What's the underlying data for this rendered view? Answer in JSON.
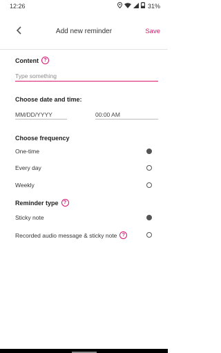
{
  "status_bar": {
    "time": "12:26",
    "battery": "31%",
    "icons": [
      "location-icon",
      "wifi-icon",
      "signal-icon",
      "battery-icon"
    ]
  },
  "app_bar": {
    "back_icon": "back-chevron-icon",
    "title": "Add new reminder",
    "save_label": "Save"
  },
  "content": {
    "title": "Content",
    "placeholder": "Type something"
  },
  "datetime": {
    "title": "Choose date and time:",
    "date_placeholder": "MM/DD/YYYY",
    "time_value": "00:00 AM"
  },
  "frequency": {
    "title": "Choose frequency",
    "options": [
      {
        "label": "One-time",
        "selected": true
      },
      {
        "label": "Every day",
        "selected": false
      },
      {
        "label": "Weekly",
        "selected": false
      }
    ]
  },
  "reminder_type": {
    "title": "Reminder type",
    "options": [
      {
        "label": "Sticky note",
        "selected": true
      },
      {
        "label": "Recorded audio message & sticky note",
        "selected": false
      }
    ]
  },
  "colors": {
    "accent": "#d9156e",
    "text": "#222222"
  }
}
